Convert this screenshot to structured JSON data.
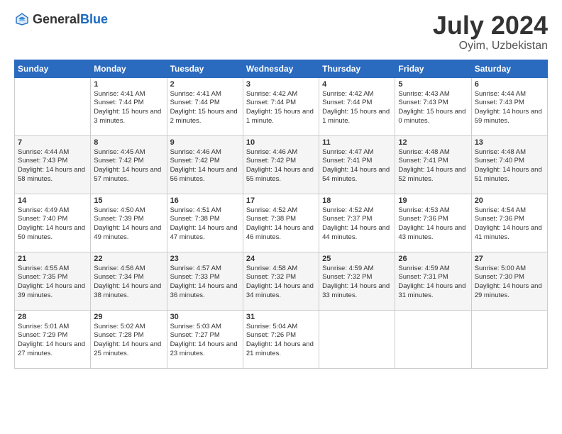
{
  "header": {
    "logo_general": "General",
    "logo_blue": "Blue",
    "month": "July 2024",
    "location": "Oyim, Uzbekistan"
  },
  "weekdays": [
    "Sunday",
    "Monday",
    "Tuesday",
    "Wednesday",
    "Thursday",
    "Friday",
    "Saturday"
  ],
  "weeks": [
    [
      {
        "day": "",
        "sunrise": "",
        "sunset": "",
        "daylight": ""
      },
      {
        "day": "1",
        "sunrise": "Sunrise: 4:41 AM",
        "sunset": "Sunset: 7:44 PM",
        "daylight": "Daylight: 15 hours and 3 minutes."
      },
      {
        "day": "2",
        "sunrise": "Sunrise: 4:41 AM",
        "sunset": "Sunset: 7:44 PM",
        "daylight": "Daylight: 15 hours and 2 minutes."
      },
      {
        "day": "3",
        "sunrise": "Sunrise: 4:42 AM",
        "sunset": "Sunset: 7:44 PM",
        "daylight": "Daylight: 15 hours and 1 minute."
      },
      {
        "day": "4",
        "sunrise": "Sunrise: 4:42 AM",
        "sunset": "Sunset: 7:44 PM",
        "daylight": "Daylight: 15 hours and 1 minute."
      },
      {
        "day": "5",
        "sunrise": "Sunrise: 4:43 AM",
        "sunset": "Sunset: 7:43 PM",
        "daylight": "Daylight: 15 hours and 0 minutes."
      },
      {
        "day": "6",
        "sunrise": "Sunrise: 4:44 AM",
        "sunset": "Sunset: 7:43 PM",
        "daylight": "Daylight: 14 hours and 59 minutes."
      }
    ],
    [
      {
        "day": "7",
        "sunrise": "Sunrise: 4:44 AM",
        "sunset": "Sunset: 7:43 PM",
        "daylight": "Daylight: 14 hours and 58 minutes."
      },
      {
        "day": "8",
        "sunrise": "Sunrise: 4:45 AM",
        "sunset": "Sunset: 7:42 PM",
        "daylight": "Daylight: 14 hours and 57 minutes."
      },
      {
        "day": "9",
        "sunrise": "Sunrise: 4:46 AM",
        "sunset": "Sunset: 7:42 PM",
        "daylight": "Daylight: 14 hours and 56 minutes."
      },
      {
        "day": "10",
        "sunrise": "Sunrise: 4:46 AM",
        "sunset": "Sunset: 7:42 PM",
        "daylight": "Daylight: 14 hours and 55 minutes."
      },
      {
        "day": "11",
        "sunrise": "Sunrise: 4:47 AM",
        "sunset": "Sunset: 7:41 PM",
        "daylight": "Daylight: 14 hours and 54 minutes."
      },
      {
        "day": "12",
        "sunrise": "Sunrise: 4:48 AM",
        "sunset": "Sunset: 7:41 PM",
        "daylight": "Daylight: 14 hours and 52 minutes."
      },
      {
        "day": "13",
        "sunrise": "Sunrise: 4:48 AM",
        "sunset": "Sunset: 7:40 PM",
        "daylight": "Daylight: 14 hours and 51 minutes."
      }
    ],
    [
      {
        "day": "14",
        "sunrise": "Sunrise: 4:49 AM",
        "sunset": "Sunset: 7:40 PM",
        "daylight": "Daylight: 14 hours and 50 minutes."
      },
      {
        "day": "15",
        "sunrise": "Sunrise: 4:50 AM",
        "sunset": "Sunset: 7:39 PM",
        "daylight": "Daylight: 14 hours and 49 minutes."
      },
      {
        "day": "16",
        "sunrise": "Sunrise: 4:51 AM",
        "sunset": "Sunset: 7:38 PM",
        "daylight": "Daylight: 14 hours and 47 minutes."
      },
      {
        "day": "17",
        "sunrise": "Sunrise: 4:52 AM",
        "sunset": "Sunset: 7:38 PM",
        "daylight": "Daylight: 14 hours and 46 minutes."
      },
      {
        "day": "18",
        "sunrise": "Sunrise: 4:52 AM",
        "sunset": "Sunset: 7:37 PM",
        "daylight": "Daylight: 14 hours and 44 minutes."
      },
      {
        "day": "19",
        "sunrise": "Sunrise: 4:53 AM",
        "sunset": "Sunset: 7:36 PM",
        "daylight": "Daylight: 14 hours and 43 minutes."
      },
      {
        "day": "20",
        "sunrise": "Sunrise: 4:54 AM",
        "sunset": "Sunset: 7:36 PM",
        "daylight": "Daylight: 14 hours and 41 minutes."
      }
    ],
    [
      {
        "day": "21",
        "sunrise": "Sunrise: 4:55 AM",
        "sunset": "Sunset: 7:35 PM",
        "daylight": "Daylight: 14 hours and 39 minutes."
      },
      {
        "day": "22",
        "sunrise": "Sunrise: 4:56 AM",
        "sunset": "Sunset: 7:34 PM",
        "daylight": "Daylight: 14 hours and 38 minutes."
      },
      {
        "day": "23",
        "sunrise": "Sunrise: 4:57 AM",
        "sunset": "Sunset: 7:33 PM",
        "daylight": "Daylight: 14 hours and 36 minutes."
      },
      {
        "day": "24",
        "sunrise": "Sunrise: 4:58 AM",
        "sunset": "Sunset: 7:32 PM",
        "daylight": "Daylight: 14 hours and 34 minutes."
      },
      {
        "day": "25",
        "sunrise": "Sunrise: 4:59 AM",
        "sunset": "Sunset: 7:32 PM",
        "daylight": "Daylight: 14 hours and 33 minutes."
      },
      {
        "day": "26",
        "sunrise": "Sunrise: 4:59 AM",
        "sunset": "Sunset: 7:31 PM",
        "daylight": "Daylight: 14 hours and 31 minutes."
      },
      {
        "day": "27",
        "sunrise": "Sunrise: 5:00 AM",
        "sunset": "Sunset: 7:30 PM",
        "daylight": "Daylight: 14 hours and 29 minutes."
      }
    ],
    [
      {
        "day": "28",
        "sunrise": "Sunrise: 5:01 AM",
        "sunset": "Sunset: 7:29 PM",
        "daylight": "Daylight: 14 hours and 27 minutes."
      },
      {
        "day": "29",
        "sunrise": "Sunrise: 5:02 AM",
        "sunset": "Sunset: 7:28 PM",
        "daylight": "Daylight: 14 hours and 25 minutes."
      },
      {
        "day": "30",
        "sunrise": "Sunrise: 5:03 AM",
        "sunset": "Sunset: 7:27 PM",
        "daylight": "Daylight: 14 hours and 23 minutes."
      },
      {
        "day": "31",
        "sunrise": "Sunrise: 5:04 AM",
        "sunset": "Sunset: 7:26 PM",
        "daylight": "Daylight: 14 hours and 21 minutes."
      },
      {
        "day": "",
        "sunrise": "",
        "sunset": "",
        "daylight": ""
      },
      {
        "day": "",
        "sunrise": "",
        "sunset": "",
        "daylight": ""
      },
      {
        "day": "",
        "sunrise": "",
        "sunset": "",
        "daylight": ""
      }
    ]
  ]
}
